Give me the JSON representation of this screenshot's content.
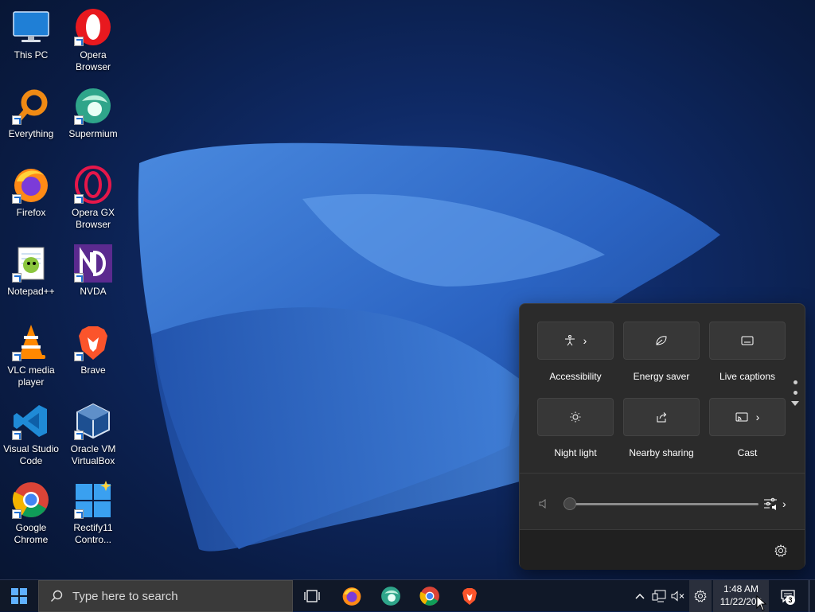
{
  "desktop": {
    "icons": [
      {
        "label": "This PC",
        "icon": "this-pc-icon",
        "shortcut": false
      },
      {
        "label": "Opera Browser",
        "icon": "opera-icon",
        "shortcut": true
      },
      {
        "label": "Everything",
        "icon": "everything-icon",
        "shortcut": true
      },
      {
        "label": "Supermium",
        "icon": "supermium-icon",
        "shortcut": true
      },
      {
        "label": "Firefox",
        "icon": "firefox-icon",
        "shortcut": true
      },
      {
        "label": "Opera GX Browser",
        "icon": "opera-gx-icon",
        "shortcut": true
      },
      {
        "label": "Notepad++",
        "icon": "notepadpp-icon",
        "shortcut": true
      },
      {
        "label": "NVDA",
        "icon": "nvda-icon",
        "shortcut": true
      },
      {
        "label": "VLC media player",
        "icon": "vlc-icon",
        "shortcut": true
      },
      {
        "label": "Brave",
        "icon": "brave-icon",
        "shortcut": true
      },
      {
        "label": "Visual Studio Code",
        "icon": "vscode-icon",
        "shortcut": true
      },
      {
        "label": "Oracle VM VirtualBox",
        "icon": "virtualbox-icon",
        "shortcut": true
      },
      {
        "label": "Google Chrome",
        "icon": "chrome-icon",
        "shortcut": true
      },
      {
        "label": "Rectify11 Contro...",
        "icon": "rectify11-icon",
        "shortcut": true
      }
    ]
  },
  "quick_settings": {
    "tiles": [
      {
        "label": "Accessibility",
        "icon": "accessibility-icon",
        "has_chevron": true
      },
      {
        "label": "Energy saver",
        "icon": "energy-saver-icon",
        "has_chevron": false
      },
      {
        "label": "Live captions",
        "icon": "live-captions-icon",
        "has_chevron": false
      },
      {
        "label": "Night light",
        "icon": "night-light-icon",
        "has_chevron": false
      },
      {
        "label": "Nearby sharing",
        "icon": "nearby-sharing-icon",
        "has_chevron": false
      },
      {
        "label": "Cast",
        "icon": "cast-icon",
        "has_chevron": true
      }
    ],
    "volume_level": 0,
    "settings_icon": "gear-icon"
  },
  "taskbar": {
    "search_placeholder": "Type here to search",
    "pinned_apps": [
      "task-view-icon",
      "firefox-icon",
      "supermium-icon",
      "chrome-icon",
      "brave-icon"
    ],
    "tray_icons": [
      "chevron-up-icon",
      "network-icon",
      "volume-muted-icon",
      "gear-icon"
    ],
    "clock": {
      "time": "1:48 AM",
      "date": "11/22/202"
    },
    "notification_count": "3"
  },
  "colors": {
    "accent": "#1f6fd1",
    "panel_bg": "#2b2b2b",
    "taskbar_bg": "#101828"
  }
}
